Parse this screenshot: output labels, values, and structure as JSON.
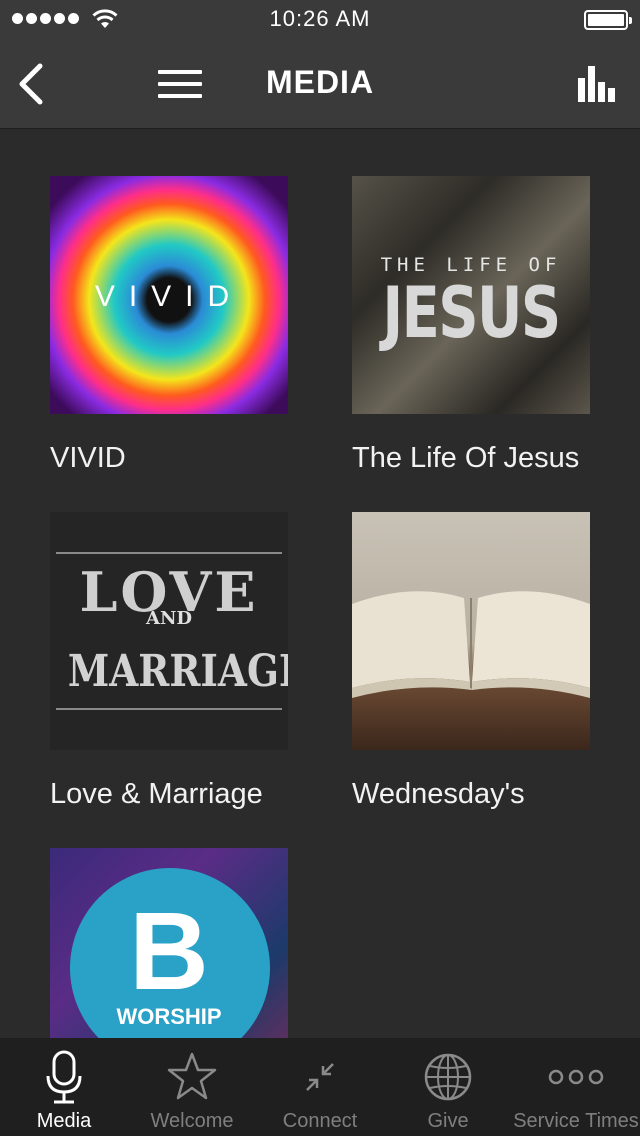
{
  "status_bar": {
    "time": "10:26 AM"
  },
  "nav": {
    "title": "MEDIA"
  },
  "media": [
    {
      "label": "VIVID",
      "art_text": "VIVID"
    },
    {
      "label": "The Life Of Jesus",
      "art_small": "THE LIFE OF",
      "art_big": "JESUS"
    },
    {
      "label": "Love & Marriage",
      "art_love": "LOVE",
      "art_and": "AND",
      "art_marriage": "MARRIAGE"
    },
    {
      "label": "Wednesday's"
    },
    {
      "art_letter": "B",
      "art_word": "WORSHIP"
    }
  ],
  "tabs": [
    {
      "label": "Media",
      "icon": "microphone-icon",
      "active": true
    },
    {
      "label": "Welcome",
      "icon": "star-icon",
      "active": false
    },
    {
      "label": "Connect",
      "icon": "collapse-arrows-icon",
      "active": false
    },
    {
      "label": "Give",
      "icon": "globe-icon",
      "active": false
    },
    {
      "label": "Service Times",
      "icon": "more-dots-icon",
      "active": false
    }
  ],
  "colors": {
    "bar": "#3a3a3a",
    "background": "#2b2b2b",
    "tabbar": "#1f1f1f",
    "inactive_tab": "#7f7f7f"
  }
}
